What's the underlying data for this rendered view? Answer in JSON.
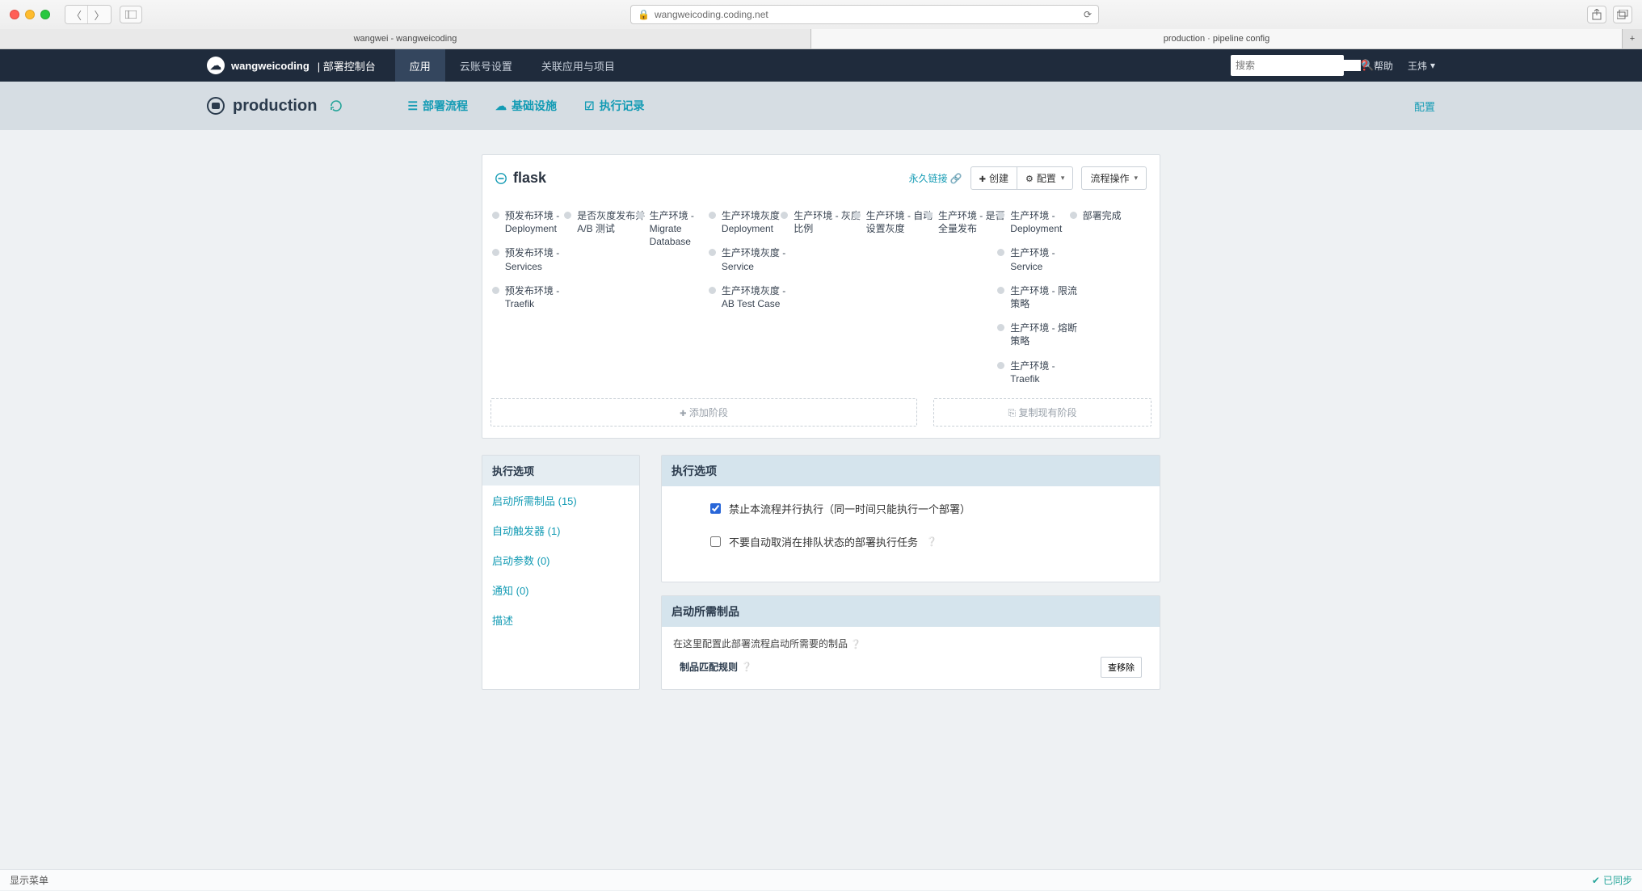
{
  "browser": {
    "url": "wangweicoding.coding.net",
    "tabs": [
      "wangwei - wangweicoding",
      "production · pipeline config"
    ]
  },
  "topnav": {
    "brand": "wangweicoding",
    "brand_sub": "| 部署控制台",
    "tabs": [
      "应用",
      "云账号设置",
      "关联应用与项目"
    ],
    "search_placeholder": "搜索",
    "help": "帮助",
    "user": "王炜"
  },
  "subheader": {
    "title": "production",
    "tabs": [
      "部署流程",
      "基础设施",
      "执行记录"
    ],
    "config": "配置"
  },
  "pipeline": {
    "title": "flask",
    "permalink": "永久链接",
    "btn_create": "创建",
    "btn_config": "配置",
    "btn_ops": "流程操作",
    "add_stage": "添加阶段",
    "copy_stage": "复制现有阶段",
    "end_label": "部署完成",
    "cols": [
      [
        "预发布环境 - Deployment",
        "预发布环境 - Services",
        "预发布环境 - Traefik"
      ],
      [
        "是否灰度发布并 A/B 测试"
      ],
      [
        "生产环境 - Migrate Database"
      ],
      [
        "生产环境灰度 - Deployment",
        "生产环境灰度 - Service",
        "生产环境灰度 - AB Test Case"
      ],
      [
        "生产环境 - 灰度比例"
      ],
      [
        "生产环境 - 自动设置灰度"
      ],
      [
        "生产环境 - 是否全量发布"
      ],
      [
        "生产环境 - Deployment",
        "生产环境 - Service",
        "生产环境 - 限流策略",
        "生产环境 - 熔断策略",
        "生产环境 - Traefik"
      ]
    ]
  },
  "side": {
    "header": "执行选项",
    "items": [
      "启动所需制品 (15)",
      "自动触发器 (1)",
      "启动参数 (0)",
      "通知 (0)",
      "描述"
    ]
  },
  "exec_options": {
    "header": "执行选项",
    "cb1_label": "禁止本流程并行执行（同一时间只能执行一个部署）",
    "cb1_checked": true,
    "cb2_label": "不要自动取消在排队状态的部署执行任务",
    "cb2_checked": false
  },
  "artifacts": {
    "header": "启动所需制品",
    "desc": "在这里配置此部署流程启动所需要的制品",
    "sub": "制品匹配规则",
    "btn": "查移除"
  },
  "footer": {
    "left": "显示菜单",
    "right": "已同步"
  }
}
